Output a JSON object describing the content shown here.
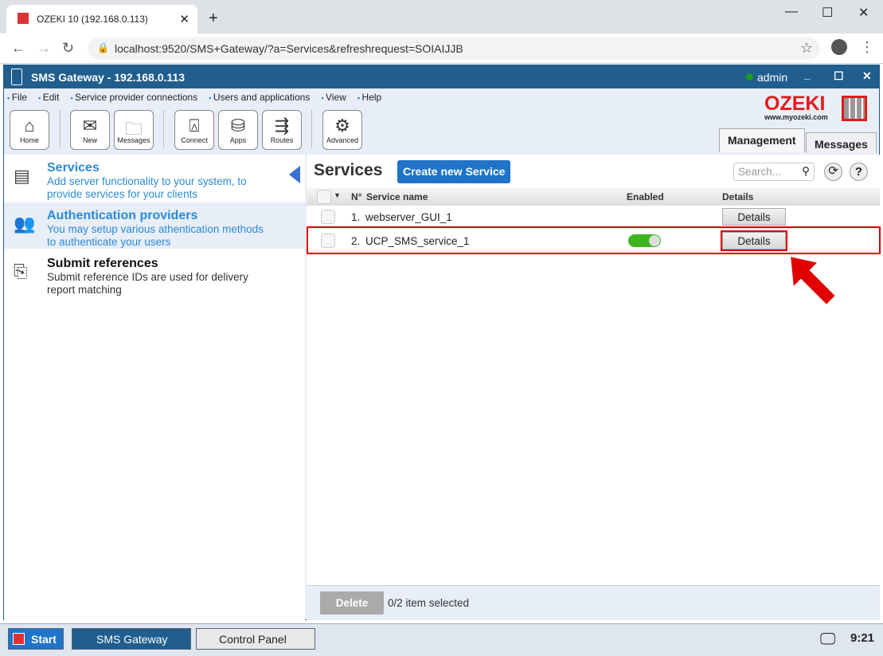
{
  "browser": {
    "tab_title": "OZEKI 10 (192.168.0.113)",
    "new_tab": "+",
    "url": "localhost:9520/SMS+Gateway/?a=Services&refreshrequest=SOIAIJJB"
  },
  "app": {
    "title": "SMS Gateway - 192.168.0.113",
    "user": "admin",
    "brand": "OZEKI",
    "brand_url": "www.myozeki.com"
  },
  "menu": [
    "File",
    "Edit",
    "Service provider connections",
    "Users and applications",
    "View",
    "Help"
  ],
  "toolbar": [
    {
      "label": "Home",
      "icon": "home-icon"
    },
    {
      "label": "New",
      "icon": "new-message-icon"
    },
    {
      "label": "Messages",
      "icon": "folder-icon"
    },
    {
      "label": "Connect",
      "icon": "antenna-icon"
    },
    {
      "label": "Apps",
      "icon": "database-icon"
    },
    {
      "label": "Routes",
      "icon": "signpost-icon"
    },
    {
      "label": "Advanced",
      "icon": "gear-icon"
    }
  ],
  "main_tabs": [
    "Management",
    "Messages"
  ],
  "sidebar": [
    {
      "title": "Services",
      "desc1": "Add server functionality to your system, to",
      "desc2": "provide services for your clients"
    },
    {
      "title": "Authentication providers",
      "desc1": "You may setup various athentication methods",
      "desc2": "to authenticate your users"
    },
    {
      "title": "Submit references",
      "desc1": "Submit reference IDs are used for delivery",
      "desc2": "report matching"
    }
  ],
  "services": {
    "heading": "Services",
    "create_button": "Create new Service",
    "search_placeholder": "Search...",
    "columns": {
      "no": "N°",
      "name": "Service name",
      "enabled": "Enabled",
      "details": "Details"
    },
    "rows": [
      {
        "no": "1.",
        "name": "webserver_GUI_1",
        "enabled": null,
        "details": "Details"
      },
      {
        "no": "2.",
        "name": "UCP_SMS_service_1",
        "enabled": true,
        "details": "Details"
      }
    ],
    "delete_button": "Delete",
    "selection_status": "0/2 item selected"
  },
  "taskbar": {
    "start": "Start",
    "items": [
      "SMS Gateway",
      "Control Panel"
    ],
    "clock": "9:21"
  },
  "colors": {
    "accent": "#2b8ad8",
    "titlebar": "#1f5e8e",
    "highlight": "#e00000",
    "toggle_on": "#3cb521"
  }
}
